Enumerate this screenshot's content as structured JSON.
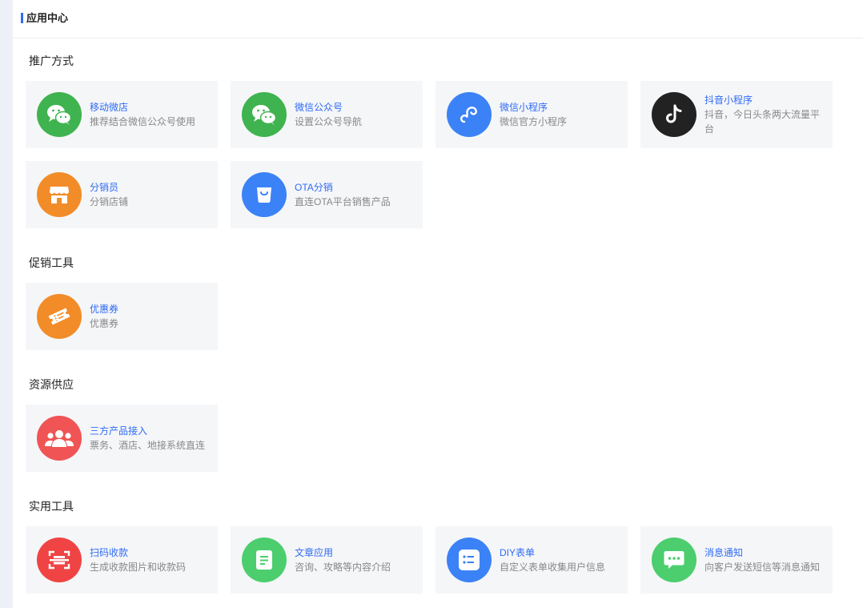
{
  "header": {
    "title": "应用中心"
  },
  "sections": [
    {
      "title": "推广方式",
      "items": [
        {
          "name": "移动微店",
          "desc": "推荐结合微信公众号使用",
          "icon": "wechat-icon",
          "color": "#3fb34f"
        },
        {
          "name": "微信公众号",
          "desc": "设置公众号导航",
          "icon": "wechat-icon",
          "color": "#3fb34f"
        },
        {
          "name": "微信小程序",
          "desc": "微信官方小程序",
          "icon": "mini-program-icon",
          "color": "#3b82f6"
        },
        {
          "name": "抖音小程序",
          "desc": "抖音，今日头条两大流量平台",
          "icon": "tiktok-icon",
          "color": "#222222"
        },
        {
          "name": "分销员",
          "desc": "分销店铺",
          "icon": "store-icon",
          "color": "#f28c28"
        },
        {
          "name": "OTA分销",
          "desc": "直连OTA平台销售产品",
          "icon": "shopping-bag-icon",
          "color": "#3b82f6"
        }
      ]
    },
    {
      "title": "促销工具",
      "items": [
        {
          "name": "优惠券",
          "desc": "优惠券",
          "icon": "coupon-icon",
          "color": "#f28c28"
        }
      ]
    },
    {
      "title": "资源供应",
      "items": [
        {
          "name": "三方产品接入",
          "desc": "票务、酒店、地接系统直连",
          "icon": "users-icon",
          "color": "#f05454"
        }
      ]
    },
    {
      "title": "实用工具",
      "items": [
        {
          "name": "扫码收款",
          "desc": "生成收款图片和收款码",
          "icon": "scan-icon",
          "color": "#f04444"
        },
        {
          "name": "文章应用",
          "desc": "咨询、攻略等内容介绍",
          "icon": "article-icon",
          "color": "#4cce6e"
        },
        {
          "name": "DIY表单",
          "desc": "自定义表单收集用户信息",
          "icon": "form-icon",
          "color": "#3b82f6"
        },
        {
          "name": "消息通知",
          "desc": "向客户发送短信等消息通知",
          "icon": "message-icon",
          "color": "#4cce6e"
        }
      ]
    }
  ]
}
